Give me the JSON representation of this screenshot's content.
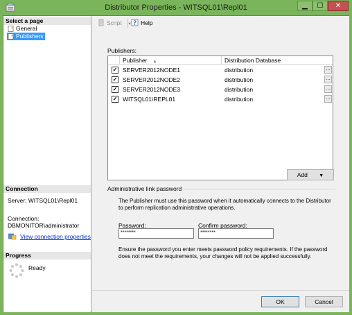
{
  "window": {
    "title": "Distributor Properties - WITSQL01\\Repl01",
    "minimize": "▁",
    "maximize": "☐",
    "close": "✕"
  },
  "sidebar": {
    "select_page_label": "Select a page",
    "pages": [
      {
        "label": "General",
        "icon": "page-icon",
        "selected": false
      },
      {
        "label": "Publishers",
        "icon": "page-icon",
        "selected": true
      }
    ],
    "connection": {
      "heading": "Connection",
      "server": "Server: WITSQL01\\Repl01",
      "connection_label": "Connection:",
      "connection_value": "DBMONITOR\\administrator",
      "link": "View connection properties"
    },
    "progress": {
      "heading": "Progress",
      "status": "Ready"
    }
  },
  "toolbar": {
    "script_label": "Script",
    "help_label": "Help"
  },
  "publishers": {
    "label": "Publishers:",
    "columns": [
      "Publisher",
      "Distribution Database"
    ],
    "rows": [
      {
        "checked": true,
        "publisher": "SERVER2012NODE1",
        "database": "distribution"
      },
      {
        "checked": true,
        "publisher": "SERVER2012NODE2",
        "database": "distribution"
      },
      {
        "checked": true,
        "publisher": "SERVER2012NODE3",
        "database": "distribution"
      },
      {
        "checked": true,
        "publisher": "WITSQL01\\REPL01",
        "database": "distribution"
      }
    ],
    "add_label": "Add",
    "ellipsis": "..."
  },
  "admin_password": {
    "group_label": "Administrative link password",
    "description": "The Publisher must use this password when it automatically connects to the Distributor to perform replication administrative operations.",
    "password_label": "Password:",
    "password_value": "********",
    "confirm_label": "Confirm password:",
    "confirm_value": "********",
    "note": "Ensure the password you enter meets password policy requirements. If the password does not meet the requirements, your changes will not be applied successfully."
  },
  "buttons": {
    "ok": "OK",
    "cancel": "Cancel"
  },
  "colors": {
    "title_bar": "#7ab55c",
    "selection": "#3399ff",
    "close_button": "#c75050",
    "link": "#0033cc"
  }
}
